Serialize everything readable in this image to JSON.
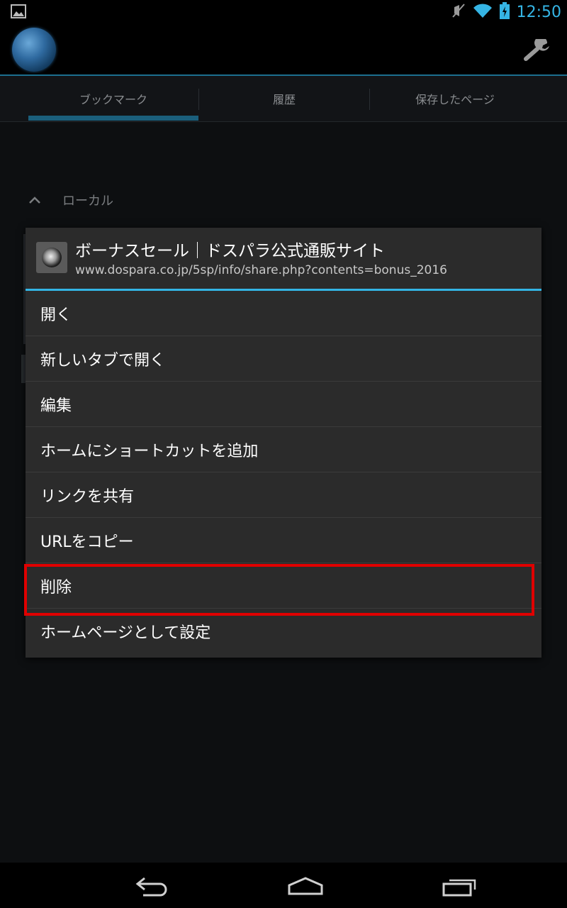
{
  "status_bar": {
    "time": "12:50"
  },
  "tabs": [
    {
      "label": "ブックマーク"
    },
    {
      "label": "履歴"
    },
    {
      "label": "保存したページ"
    }
  ],
  "section": {
    "label": "ローカル"
  },
  "dialog": {
    "title": "ボーナスセール｜ドスパラ公式通販サイト",
    "url": "www.dospara.co.jp/5sp/info/share.php?contents=bonus_2016",
    "items": [
      {
        "label": "開く"
      },
      {
        "label": "新しいタブで開く"
      },
      {
        "label": "編集"
      },
      {
        "label": "ホームにショートカットを追加"
      },
      {
        "label": "リンクを共有"
      },
      {
        "label": "URLをコピー"
      },
      {
        "label": "削除"
      },
      {
        "label": "ホームページとして設定"
      }
    ],
    "highlighted_item": "削除"
  },
  "colors": {
    "accent": "#33b5e5",
    "highlight_border": "#e00000"
  },
  "icons": [
    "image-notification-icon",
    "no-sound-icon",
    "wifi-icon",
    "battery-icon",
    "browser-logo-icon",
    "wrench-icon",
    "chevron-up-icon",
    "favicon-icon",
    "back-icon",
    "home-icon",
    "recent-apps-icon"
  ]
}
